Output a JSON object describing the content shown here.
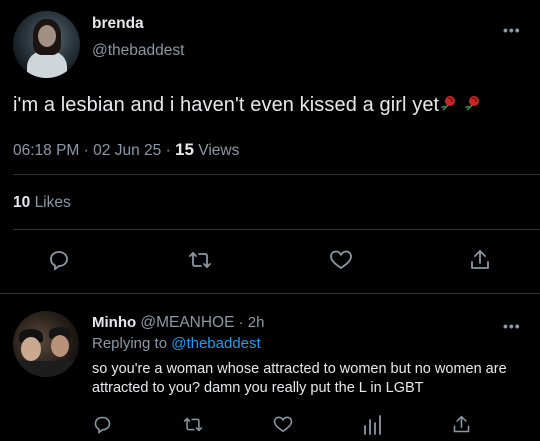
{
  "tweet": {
    "author": {
      "display_name": "brenda",
      "handle": "@thebaddest"
    },
    "more_icon": "more-horizontal-icon",
    "text": "i'm a lesbian and i haven't even kissed a girl yet",
    "emoji": [
      "rose-icon",
      "rose-icon"
    ],
    "meta": {
      "time": "06:18 PM",
      "separator": "·",
      "date": "02 Jun 25",
      "separator2": "·",
      "views_count": "15",
      "views_label": "Views"
    },
    "stats": {
      "likes_count": "10",
      "likes_label": "Likes"
    },
    "actions": [
      "reply-icon",
      "retweet-icon",
      "like-icon",
      "share-icon"
    ]
  },
  "reply": {
    "author": {
      "display_name": "Minho",
      "handle": "@MEANHOE",
      "separator": "·",
      "time": "2h"
    },
    "replying_to_label": "Replying to",
    "replying_to_handle": "@thebaddest",
    "text": "so you're a woman whose attracted to women but no women are attracted to you? damn you really put the L in LGBT",
    "actions": [
      "reply-icon",
      "retweet-icon",
      "like-icon",
      "views-icon",
      "share-icon"
    ]
  },
  "colors": {
    "background": "#000000",
    "text": "#e7e9ea",
    "secondary": "#8b98a5",
    "link": "#1d9bf0",
    "divider": "#2f3336"
  }
}
